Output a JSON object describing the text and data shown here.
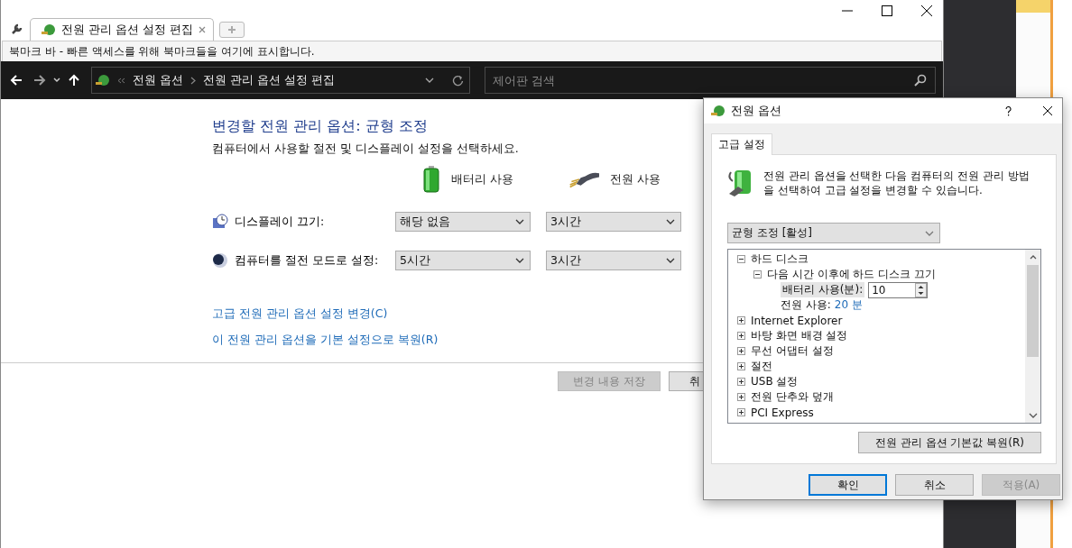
{
  "browser": {
    "tabs": [
      {
        "label": "전원 관리 옵션 설정 편집",
        "selected": true
      }
    ],
    "bookmark_bar": "북마크 바 - 빠른 액세스를 위해 북마크들을 여기에 표시합니다."
  },
  "address_bar": {
    "breadcrumb": [
      "전원 옵션",
      "전원 관리 옵션 설정 편집"
    ],
    "search": {
      "placeholder": "제어판 검색"
    }
  },
  "page": {
    "title": "변경할 전원 관리 옵션: 균형 조정",
    "subtitle": "컴퓨터에서 사용할 절전 및 디스플레이 설정을 선택하세요.",
    "columns": [
      {
        "label": "배터리 사용",
        "kind": "battery"
      },
      {
        "label": "전원 사용",
        "kind": "plug"
      }
    ],
    "settings": [
      {
        "label": "디스플레이 끄기:",
        "kind": "display",
        "values": [
          "해당 없음",
          "3시간"
        ]
      },
      {
        "label": "컴퓨터를 절전 모드로 설정:",
        "kind": "sleep",
        "values": [
          "5시간",
          "3시간"
        ]
      }
    ],
    "links": [
      "고급 전원 관리 옵션 설정 변경(C)",
      "이 전원 관리 옵션을 기본 설정으로 복원(R)"
    ],
    "buttons": [
      {
        "label": "변경 내용 저장",
        "disabled": true
      },
      {
        "label": "취",
        "disabled": false
      }
    ]
  },
  "dialog": {
    "title": "전원 옵션",
    "tabs": [
      {
        "label": "고급 설정",
        "selected": true
      }
    ],
    "description": "전원 관리 옵션을 선택한 다음 컴퓨터의 전원 관리 방법을 선택하여 고급 설정을 변경할 수 있습니다.",
    "plan": "균형 조정 [활성]",
    "tree": [
      {
        "label": "하드 디스크",
        "expanded": true,
        "children": [
          {
            "label": "다음 시간 이후에 하드 디스크 끄기",
            "expanded": true,
            "children": [
              {
                "kind": "spin",
                "label": "배터리 사용(분):",
                "value": "10"
              },
              {
                "kind": "value",
                "label": "전원 사용:",
                "value": "20 분"
              }
            ]
          }
        ]
      },
      {
        "label": "Internet Explorer",
        "expanded": false
      },
      {
        "label": "바탕 화면 배경 설정",
        "expanded": false
      },
      {
        "label": "무선 어댑터 설정",
        "expanded": false
      },
      {
        "label": "절전",
        "expanded": false
      },
      {
        "label": "USB 설정",
        "expanded": false
      },
      {
        "label": "전원 단추와 덮개",
        "expanded": false
      },
      {
        "label": "PCI Express",
        "expanded": false
      }
    ],
    "restore_button": "전원 관리 옵션 기본값 복원(R)",
    "buttons": [
      {
        "label": "확인",
        "default": true,
        "disabled": false
      },
      {
        "label": "취소",
        "default": false,
        "disabled": false
      },
      {
        "label": "적용(A)",
        "default": false,
        "disabled": true
      }
    ]
  }
}
